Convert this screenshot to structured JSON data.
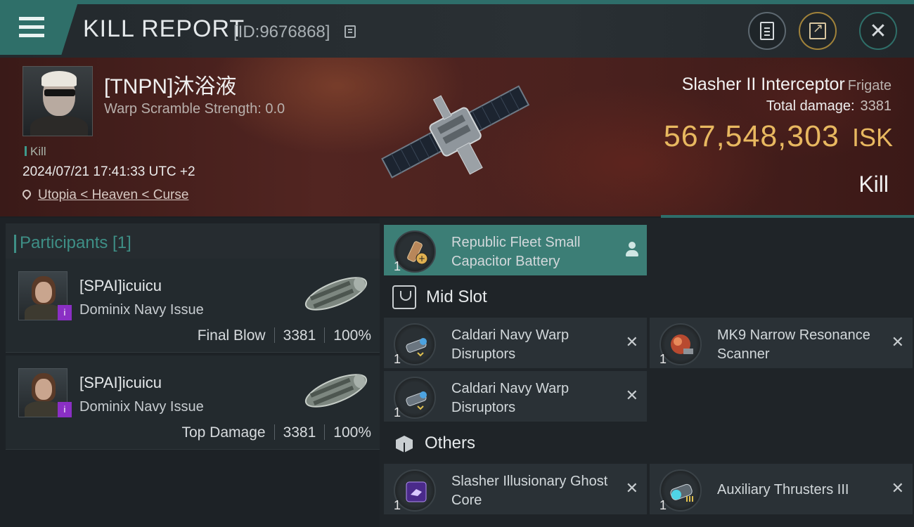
{
  "header": {
    "title": "KILL REPORT",
    "report_id": "[ID:9676868]"
  },
  "victim": {
    "name": "[TNPN]沐浴液",
    "warp_scramble": "Warp Scramble Strength: 0.0",
    "tag": "Kill",
    "timestamp": "2024/07/21 17:41:33 UTC +2",
    "location": "Utopia < Heaven < Curse",
    "ship_name": "Slasher II Interceptor",
    "ship_class": "Frigate",
    "damage_label": "Total damage:",
    "damage_value": "3381",
    "isk_value": "567,548,303",
    "isk_unit": "ISK",
    "result": "Kill"
  },
  "participants": {
    "title": "Participants [1]",
    "list": [
      {
        "name": "[SPAI]icuicu",
        "ship": "Dominix Navy Issue",
        "badge": "i",
        "role": "Final Blow",
        "damage": "3381",
        "percent": "100%"
      },
      {
        "name": "[SPAI]icuicu",
        "ship": "Dominix Navy Issue",
        "badge": "i",
        "role": "Top Damage",
        "damage": "3381",
        "percent": "100%"
      }
    ]
  },
  "fitting": {
    "top_item": {
      "name": "Republic Fleet Small Capacitor Battery",
      "qty": "1"
    },
    "mid_slot_label": "Mid Slot",
    "mid_items": [
      {
        "name": "Caldari Navy Warp Disruptors",
        "qty": "1"
      },
      {
        "name": "MK9 Narrow Resonance Scanner",
        "qty": "1"
      },
      {
        "name": "Caldari Navy Warp Disruptors",
        "qty": "1"
      }
    ],
    "others_label": "Others",
    "other_items": [
      {
        "name": "Slasher Illusionary Ghost Core",
        "qty": "1"
      },
      {
        "name": "Auxiliary Thrusters III",
        "qty": "1"
      }
    ],
    "close_glyph": "✕"
  },
  "colors": {
    "accent_teal": "#2f6f69",
    "isk_gold": "#e8b860",
    "badge_purple": "#8a2fc4"
  }
}
